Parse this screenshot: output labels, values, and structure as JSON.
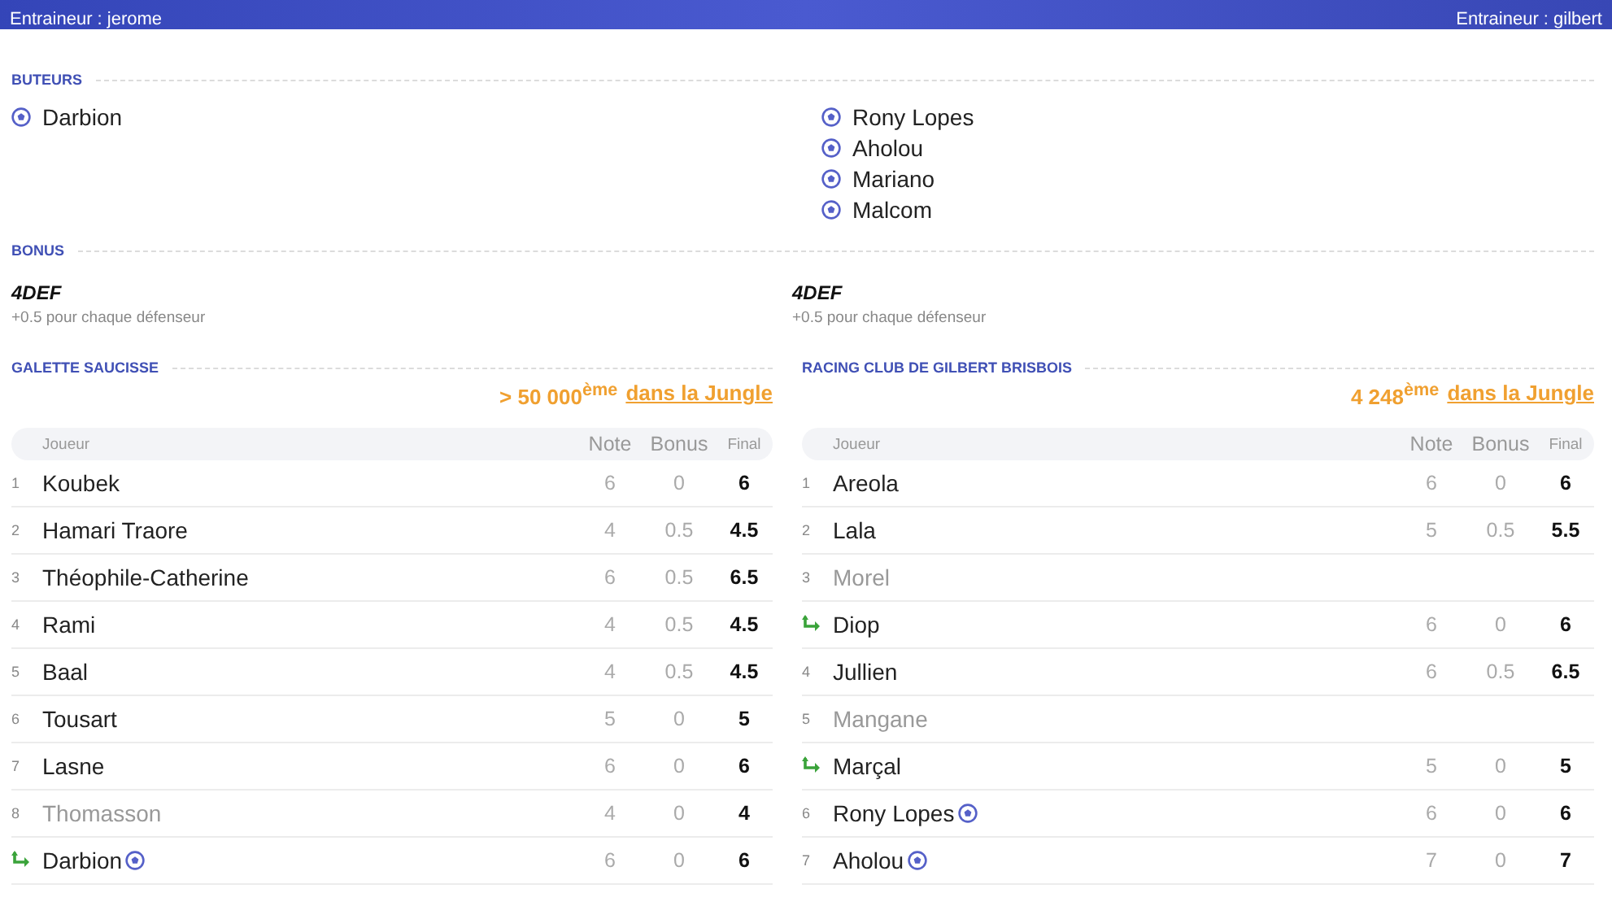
{
  "banner": {
    "left_coach": "Entraineur : jerome",
    "right_coach": "Entraineur : gilbert"
  },
  "scorers": {
    "title": "BUTEURS",
    "left": [
      "Darbion"
    ],
    "right": [
      "Rony Lopes",
      "Aholou",
      "Mariano",
      "Malcom"
    ]
  },
  "bonus": {
    "title": "BONUS",
    "left": {
      "name": "4DEF",
      "description": "+0.5 pour chaque défenseur"
    },
    "right": {
      "name": "4DEF",
      "description": "+0.5 pour chaque défenseur"
    }
  },
  "teams": [
    {
      "name": "GALETTE SAUCISSE",
      "rank": "> 50 000$^{ème}$",
      "rank_link": "dans la Jungle",
      "columns": [
        "Joueur",
        "Note",
        "Bonus",
        "Final"
      ],
      "rows": [
        {
          "kind": "starter",
          "number": "1",
          "name": "Koubek",
          "scored": false,
          "greyed": false,
          "note": "6",
          "bonus": "0",
          "final": "6"
        },
        {
          "kind": "starter",
          "number": "2",
          "name": "Hamari Traore",
          "scored": false,
          "greyed": false,
          "note": "4",
          "bonus": "0.5",
          "final": "4.5"
        },
        {
          "kind": "starter",
          "number": "3",
          "name": "Théophile-Catherine",
          "scored": false,
          "greyed": false,
          "note": "6",
          "bonus": "0.5",
          "final": "6.5"
        },
        {
          "kind": "starter",
          "number": "4",
          "name": "Rami",
          "scored": false,
          "greyed": false,
          "note": "4",
          "bonus": "0.5",
          "final": "4.5"
        },
        {
          "kind": "starter",
          "number": "5",
          "name": "Baal",
          "scored": false,
          "greyed": false,
          "note": "4",
          "bonus": "0.5",
          "final": "4.5"
        },
        {
          "kind": "starter",
          "number": "6",
          "name": "Tousart",
          "scored": false,
          "greyed": false,
          "note": "5",
          "bonus": "0",
          "final": "5"
        },
        {
          "kind": "starter",
          "number": "7",
          "name": "Lasne",
          "scored": false,
          "greyed": false,
          "note": "6",
          "bonus": "0",
          "final": "6"
        },
        {
          "kind": "starter",
          "number": "8",
          "name": "Thomasson",
          "scored": false,
          "greyed": true,
          "note": "4",
          "bonus": "0",
          "final": "4"
        },
        {
          "kind": "substitute",
          "name": "Darbion",
          "scored": true,
          "greyed": false,
          "note": "6",
          "bonus": "0",
          "final": "6"
        }
      ]
    },
    {
      "name": "RACING CLUB DE GILBERT BRISBOIS",
      "rank": "4 248$^{ème}$",
      "rank_link": "dans la Jungle",
      "columns": [
        "Joueur",
        "Note",
        "Bonus",
        "Final"
      ],
      "rows": [
        {
          "kind": "starter",
          "number": "1",
          "name": "Areola",
          "scored": false,
          "greyed": false,
          "note": "6",
          "bonus": "0",
          "final": "6"
        },
        {
          "kind": "starter",
          "number": "2",
          "name": "Lala",
          "scored": false,
          "greyed": false,
          "note": "5",
          "bonus": "0.5",
          "final": "5.5"
        },
        {
          "kind": "starter",
          "number": "3",
          "name": "Morel",
          "scored": false,
          "greyed": true
        },
        {
          "kind": "substitute",
          "name": "Diop",
          "scored": false,
          "greyed": false,
          "note": "6",
          "bonus": "0",
          "final": "6"
        },
        {
          "kind": "starter",
          "number": "4",
          "name": "Jullien",
          "scored": false,
          "greyed": false,
          "note": "6",
          "bonus": "0.5",
          "final": "6.5"
        },
        {
          "kind": "starter",
          "number": "5",
          "name": "Mangane",
          "scored": false,
          "greyed": true
        },
        {
          "kind": "substitute",
          "name": "Marçal",
          "scored": false,
          "greyed": false,
          "note": "5",
          "bonus": "0",
          "final": "5"
        },
        {
          "kind": "starter",
          "number": "6",
          "name": "Rony Lopes",
          "scored": true,
          "greyed": false,
          "note": "6",
          "bonus": "0",
          "final": "6"
        },
        {
          "kind": "starter",
          "number": "7",
          "name": "Aholou",
          "scored": true,
          "greyed": false,
          "note": "7",
          "bonus": "0",
          "final": "7"
        }
      ]
    }
  ]
}
